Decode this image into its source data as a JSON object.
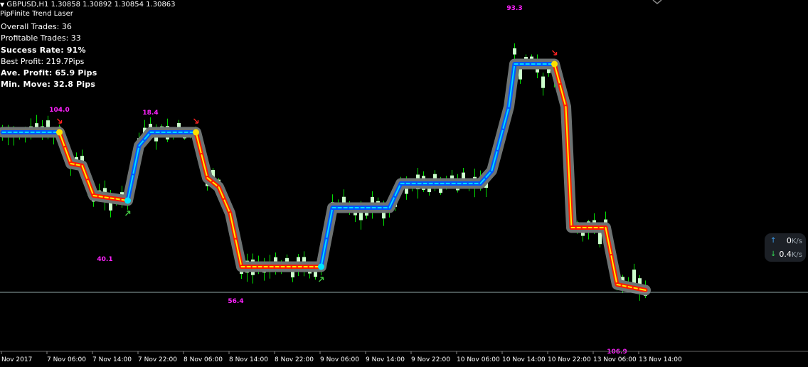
{
  "header": {
    "symbol_line": "GBPUSD,H1  1.30858 1.30892 1.30854 1.30863",
    "indicator": "PipFinite Trend Laser"
  },
  "stats": {
    "overall_trades": "Overall Trades: 36",
    "profitable_trades": "Profitable Trades: 33",
    "success_rate": "Success Rate: 91%",
    "best_profit": "Best Profit: 219.7Pips",
    "ave_profit": "Ave. Profit: 65.9 Pips",
    "min_move": "Min. Move: 32.8 Pips"
  },
  "colors": {
    "background": "#000000",
    "bull_candle": "#ccffcc",
    "wick": "#00dd00",
    "down_line_outer": "#ff1a00",
    "down_line_inner": "#ffee00",
    "up_line_outer": "#0055ff",
    "up_line_inner": "#00ddff",
    "halo": "#6e7373",
    "buy_arrow": "#44cc44",
    "sell_arrow": "#ff2222",
    "annotation": "#ff22ff",
    "price_line": "#8fa6a6"
  },
  "chart_data": {
    "type": "candlestick",
    "x_ticks": [
      "Nov 2017",
      "7 Nov 06:00",
      "7 Nov 14:00",
      "7 Nov 22:00",
      "8 Nov 06:00",
      "8 Nov 14:00",
      "8 Nov 22:00",
      "9 Nov 06:00",
      "9 Nov 14:00",
      "9 Nov 22:00",
      "10 Nov 06:00",
      "10 Nov 14:00",
      "10 Nov 22:00",
      "13 Nov 06:00",
      "13 Nov 14:00"
    ],
    "annotations": [
      {
        "text": "104.0",
        "bar": 10
      },
      {
        "text": "40.1",
        "bar": 18
      },
      {
        "text": "18.4",
        "bar": 26
      },
      {
        "text": "56.4",
        "bar": 41
      },
      {
        "text": "93.3",
        "bar": 90
      },
      {
        "text": "106.9",
        "bar": 108
      }
    ],
    "signals": [
      {
        "type": "sell",
        "bar": 10
      },
      {
        "type": "buy",
        "bar": 22
      },
      {
        "type": "sell",
        "bar": 34
      },
      {
        "type": "buy",
        "bar": 56
      },
      {
        "type": "sell",
        "bar": 97
      }
    ],
    "network_widget": {
      "upload": "0",
      "download": "0.4",
      "unit": "K/s"
    }
  }
}
